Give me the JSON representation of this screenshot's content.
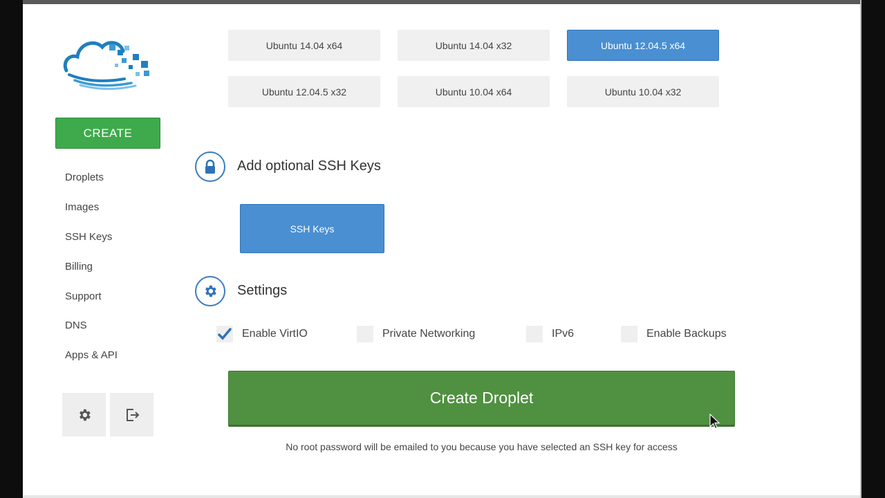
{
  "sidebar": {
    "create_label": "CREATE",
    "items": [
      {
        "label": "Droplets"
      },
      {
        "label": "Images"
      },
      {
        "label": "SSH Keys"
      },
      {
        "label": "Billing"
      },
      {
        "label": "Support"
      },
      {
        "label": "DNS"
      },
      {
        "label": "Apps & API"
      }
    ],
    "settings_icon": "gear-icon",
    "logout_icon": "logout-icon"
  },
  "images": [
    {
      "label": "Ubuntu 14.04 x64",
      "selected": false
    },
    {
      "label": "Ubuntu 14.04 x32",
      "selected": false
    },
    {
      "label": "Ubuntu 12.04.5 x64",
      "selected": true
    },
    {
      "label": "Ubuntu 12.04.5 x32",
      "selected": false
    },
    {
      "label": "Ubuntu 10.04 x64",
      "selected": false
    },
    {
      "label": "Ubuntu 10.04 x32",
      "selected": false
    }
  ],
  "ssh_section": {
    "title": "Add optional SSH Keys",
    "icon": "lock-icon",
    "button_label": "SSH Keys"
  },
  "settings_section": {
    "title": "Settings",
    "icon": "gear-icon",
    "options": [
      {
        "label": "Enable VirtIO",
        "checked": true
      },
      {
        "label": "Private Networking",
        "checked": false
      },
      {
        "label": "IPv6",
        "checked": false
      },
      {
        "label": "Enable Backups",
        "checked": false
      }
    ]
  },
  "create_droplet_label": "Create Droplet",
  "notice": "No root password will be emailed to you because you have selected an SSH key for access",
  "colors": {
    "create_green": "#3eaa4b",
    "droplet_green": "#4f9140",
    "selected_blue": "#4a8fd2",
    "accent_blue": "#3a7cc0"
  }
}
